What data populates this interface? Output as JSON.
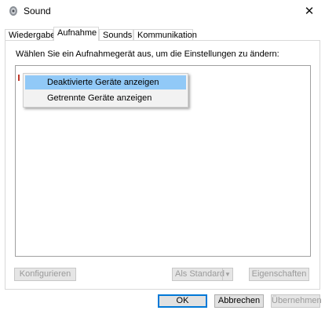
{
  "window": {
    "title": "Sound",
    "close_glyph": "✕",
    "icon": "speaker-icon"
  },
  "tabs": [
    {
      "label": "Wiedergabe",
      "active": false
    },
    {
      "label": "Aufnahme",
      "active": true
    },
    {
      "label": "Sounds",
      "active": false
    },
    {
      "label": "Kommunikation",
      "active": false
    }
  ],
  "recording": {
    "instruction": "Wählen Sie ein Aufnahmegerät aus, um die Einstellungen zu ändern:"
  },
  "context_menu": {
    "items": [
      {
        "label": "Deaktivierte Geräte anzeigen",
        "highlighted": true
      },
      {
        "label": "Getrennte Geräte anzeigen",
        "highlighted": false
      }
    ]
  },
  "panel_buttons": {
    "configure": "Konfigurieren",
    "set_default": "Als Standard",
    "set_default_arrow": "▼",
    "properties": "Eigenschaften"
  },
  "dialog_buttons": {
    "ok": "OK",
    "cancel": "Abbrechen",
    "apply": "Übernehmen"
  },
  "colors": {
    "accent": "#0078d7",
    "menu_highlight": "#91c9f7"
  }
}
